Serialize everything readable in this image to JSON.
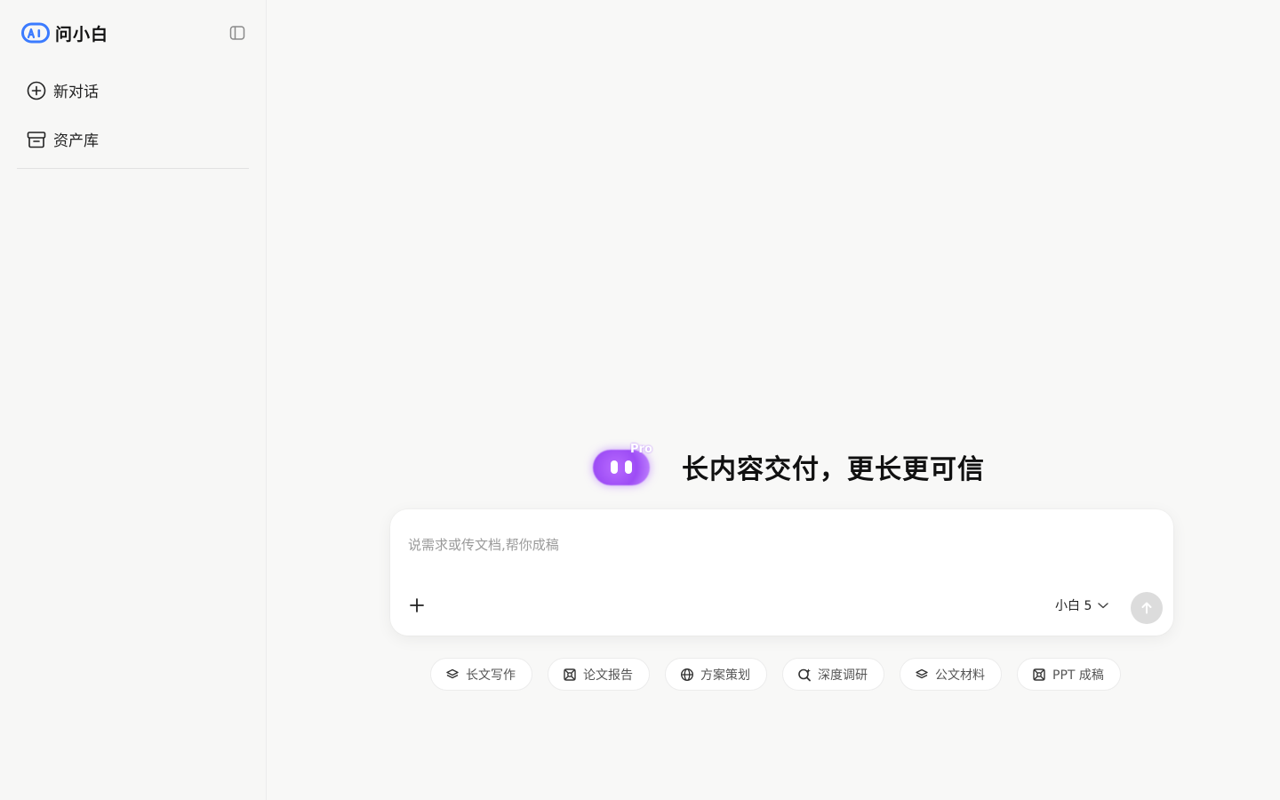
{
  "brand": {
    "name": "问小白",
    "logo_icon": "ai-logo-icon",
    "accent": "#3b7bff"
  },
  "sidebar": {
    "collapse_icon": "sidebar-toggle-icon",
    "items": [
      {
        "label": "新对话",
        "icon": "plus-circle-icon"
      },
      {
        "label": "资产库",
        "icon": "archive-box-icon"
      }
    ]
  },
  "hero": {
    "badge": "Pro",
    "title": "长内容交付，更长更可信",
    "mascot_color": "#a259ff"
  },
  "composer": {
    "placeholder": "说需求或传文档,帮你成稿",
    "value": "",
    "model": "小白 5",
    "send_enabled": false
  },
  "chips": [
    {
      "label": "长文写作",
      "icon": "stack-icon"
    },
    {
      "label": "论文报告",
      "icon": "atom-icon"
    },
    {
      "label": "方案策划",
      "icon": "globe-icon"
    },
    {
      "label": "深度调研",
      "icon": "search-spark-icon"
    },
    {
      "label": "公文材料",
      "icon": "stack-icon"
    },
    {
      "label": "PPT 成稿",
      "icon": "atom-icon"
    }
  ]
}
